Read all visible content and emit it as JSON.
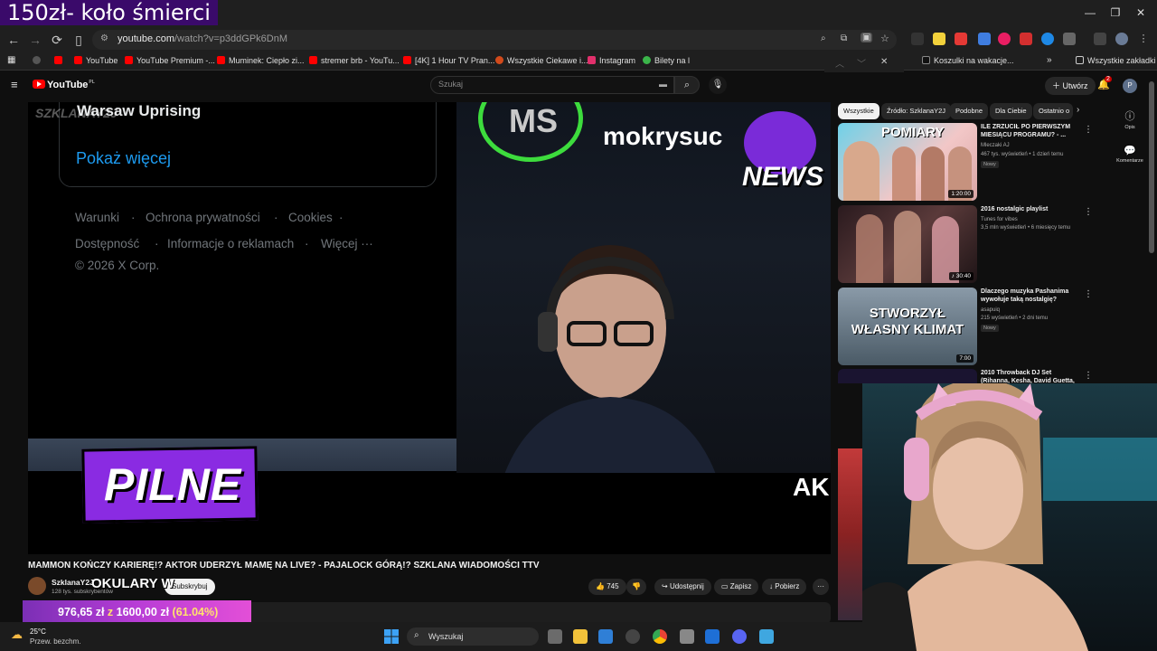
{
  "stream_overlay": {
    "title": "150zł- koło śmierci"
  },
  "window_controls": {
    "minimize": "—",
    "restore": "❐",
    "close": "✕"
  },
  "browser": {
    "url_host": "youtube.com",
    "url_path": "/watch?v=p3ddGPk6DnM",
    "nav": {
      "back": "←",
      "forward": "→",
      "reload": "⟳"
    }
  },
  "bookmarks": [
    {
      "label": "YouTube",
      "color": "#ff0000"
    },
    {
      "label": "YouTube Premium -...",
      "color": "#ff0000"
    },
    {
      "label": "Muminek: Ciepło zi...",
      "color": "#ff0000"
    },
    {
      "label": "stremer brb - YouTu...",
      "color": "#ff0000"
    },
    {
      "label": "[4K] 1 Hour TV Pran...",
      "color": "#ff0000"
    },
    {
      "label": "Wszystkie Ciekawe i...",
      "color": "#d24a1b"
    },
    {
      "label": "Instagram",
      "color": "#e1306c"
    },
    {
      "label": "Bilety na l",
      "color": "#3bb54a"
    },
    {
      "label": "Koszulki na wakacje...",
      "color": "#111111"
    }
  ],
  "bookmarks_all": "Wszystkie zakładki",
  "youtube": {
    "logo": "YouTube",
    "logo_region": "PL",
    "search_placeholder": "Szukaj",
    "create_label": "Utwórz",
    "notifications_count": "2",
    "avatar_letter": "P"
  },
  "player": {
    "x_card_title": "Warsaw Uprising",
    "x_show_more": "Pokaż więcej",
    "x_footer": [
      "Warunki",
      "Ochrona prywatności",
      "Cookies",
      "Dostępność",
      "Informacje o reklamach",
      "Więcej ···",
      "© 2026 X Corp."
    ],
    "watermark": "SZKLANAY2J",
    "cam_badge": "MS",
    "cam_name": "mokrysuc",
    "news_label": "NEWS",
    "pilne": "PILNE",
    "ticker": "AK"
  },
  "video": {
    "title": "MAMMON KOŃCZY KARIERĘ!? AKTOR UDERZYŁ MAMĘ NA LIVE? - PAJALOCK GÓRĄ!? SZKLANA WIADOMOŚCI TTV",
    "channel": "SzklanaY2J",
    "subscribers": "128 tys. subskrybentów",
    "overlay_text": "OKULARY W",
    "subscribe": "Subskrybuj",
    "likes": "745",
    "share": "Udostępnij",
    "save": "Zapisz",
    "download": "Pobierz"
  },
  "donation": {
    "current": "976,65 zł",
    "separator": "z",
    "goal": "1600,00 zł",
    "percent": "(61.04%)",
    "progress": 0.6104
  },
  "sidebar": {
    "chips": [
      "Wszystkie",
      "Źródło: SzklanaY2J",
      "Podobne",
      "Dla Ciebie",
      "Ostatnio o"
    ],
    "recommendations": [
      {
        "title": "ILE ZRZUCIŁ PO PIERWSZYM MIESIĄCU PROGRAMU? - ...",
        "channel": "Mleczaki AJ",
        "meta": "467 tys. wyświetleń • 1 dzień temu",
        "badge": "Nowy",
        "duration": "1:20:00",
        "thumb_text": "POMIARY"
      },
      {
        "title": "2016 nostalgic playlist",
        "channel": "Tunes for vibes",
        "meta": "3,5 mln wyświetleń • 6 miesięcy temu",
        "badge": "",
        "duration": "♪ 30:40",
        "thumb_text": ""
      },
      {
        "title": "Dlaczego muzyka Pashanima wywołuje taką nostalgię?",
        "channel": "asapuiq",
        "meta": "215 wyświetleń • 2 dni temu",
        "badge": "Nowy",
        "duration": "7:00",
        "thumb_text": "STWORZYŁ WŁASNY KLIMAT"
      },
      {
        "title": "2010 Throwback DJ Set (Rihanna, Kesha, David Guetta, Taio Cruz, ...",
        "channel": "",
        "meta": "",
        "badge": "",
        "duration": "",
        "thumb_text": ""
      }
    ]
  },
  "right_rail": {
    "description": "Opis",
    "comments": "Komentarze"
  },
  "taskbar": {
    "temperature": "25°C",
    "weather": "Przew. bezchm.",
    "search": "Wyszukaj"
  }
}
